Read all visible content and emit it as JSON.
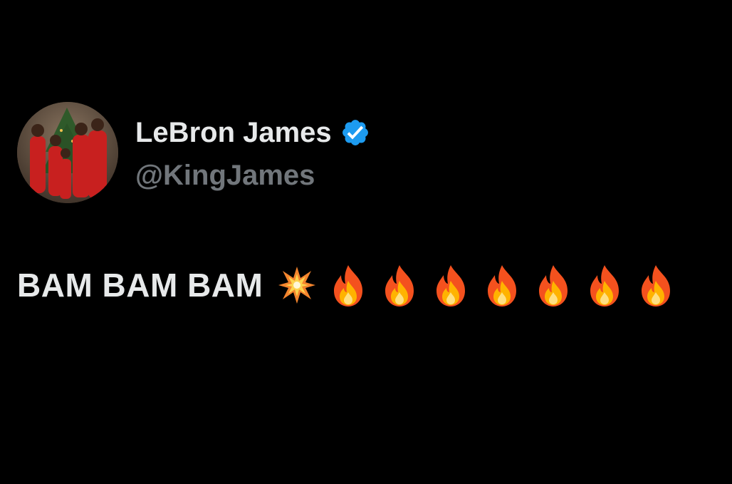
{
  "tweet": {
    "display_name": "LeBron James",
    "handle": "@KingJames",
    "verified": true,
    "text": "BAM BAM BAM",
    "emojis": [
      "collision",
      "fire",
      "fire",
      "fire",
      "fire",
      "fire",
      "fire",
      "fire"
    ]
  },
  "colors": {
    "background": "#000000",
    "name": "#e7e9ea",
    "handle": "#71767b",
    "verified_badge": "#1d9bf0"
  },
  "icons": {
    "avatar": "avatar-photo",
    "verified": "verified-badge-icon",
    "collision": "collision-emoji-icon",
    "fire": "fire-emoji-icon"
  }
}
